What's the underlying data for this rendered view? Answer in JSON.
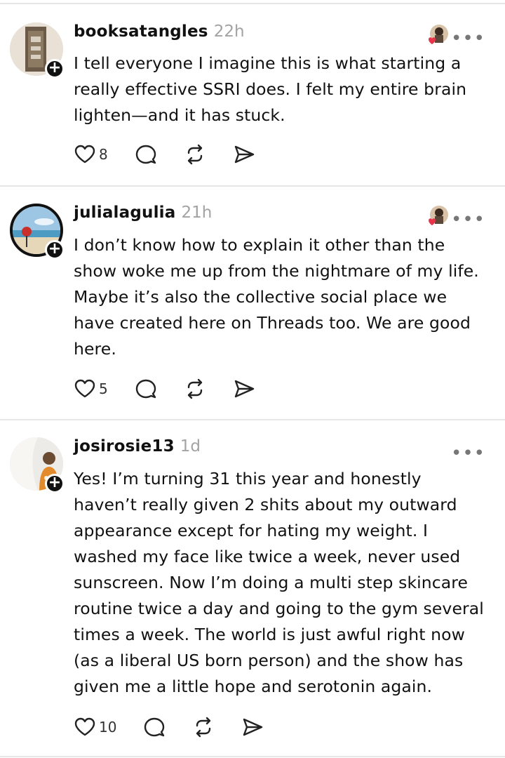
{
  "posts": [
    {
      "username": "booksatangles",
      "time": "22h",
      "text": "I tell everyone I imagine this is what starting a really effective SSRI does. I felt my entire brain lighten—and it has stuck.",
      "likes": "8",
      "liked_by_author": true
    },
    {
      "username": "julialagulia",
      "time": "21h",
      "text": "I don’t know how to explain it other than the show woke me up from the nightmare of my life. Maybe it’s also the collective social place we have created here on Threads too. We are good here.",
      "likes": "5",
      "liked_by_author": true
    },
    {
      "username": "josirosie13",
      "time": "1d",
      "text": "Yes! I’m turning 31 this year and honestly haven’t really given 2 shits about my outward appearance except for hating my weight. I washed my face like twice a week, never used sunscreen. Now I’m doing a multi step skincare routine twice a day and going to the gym several times a week. The world is just awful right now (as a liberal US born person) and the show has given me a little hope and serotonin again.",
      "likes": "10",
      "liked_by_author": false
    }
  ],
  "icons": {
    "like": "heart-outline-icon",
    "reply": "comment-bubble-icon",
    "repost": "repost-arrows-icon",
    "share": "send-icon",
    "more": "more-dots-icon",
    "follow": "plus-icon"
  },
  "colors": {
    "heart_badge": "#e8344a",
    "muted_text": "#a3a3a3"
  }
}
